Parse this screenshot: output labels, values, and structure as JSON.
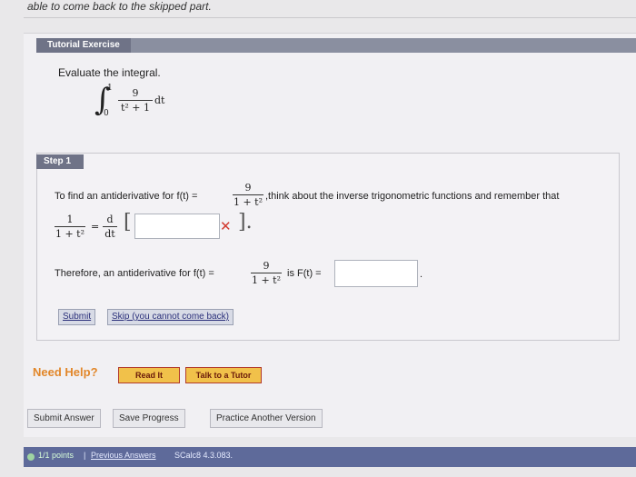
{
  "top_text": "able to come back to the skipped part.",
  "tutorial": {
    "tab_label": "Tutorial Exercise",
    "prompt": "Evaluate the integral.",
    "integral": {
      "upper": "1",
      "lower": "0",
      "numerator": "9",
      "denominator": "t² + 1",
      "differential": "dt"
    }
  },
  "step": {
    "title": "Step 1",
    "line1_before": "To find an antiderivative for f(t) =",
    "line1_frac_num": "9",
    "line1_frac_den": "1 + t²",
    "line1_after": ",think about the inverse trigonometric functions and remember that",
    "eq_left_num": "1",
    "eq_left_den": "1 + t²",
    "eq_equals": "=",
    "eq_deriv_num": "d",
    "eq_deriv_den": "dt",
    "bracket_open": "[",
    "bracket_close": "].",
    "answer1_value": "",
    "cross_mark": "✕",
    "therefore_before": "Therefore, an antiderivative for f(t) =",
    "therefore_frac_num": "9",
    "therefore_frac_den": "1 + t²",
    "therefore_after": "is F(t) =",
    "answer2_value": "",
    "period": "."
  },
  "buttons": {
    "submit": "Submit",
    "skip": "Skip (you cannot come back)",
    "read_it": "Read It",
    "talk_tutor": "Talk to a Tutor",
    "submit_answer": "Submit Answer",
    "save_progress": "Save Progress",
    "practice_another": "Practice Another Version"
  },
  "help_label": "Need Help?",
  "footer": {
    "points": "1/1 points",
    "separator": "|",
    "previous": "Previous Answers",
    "code": "SCalc8 4.3.083."
  },
  "colors": {
    "header": "#6f7387",
    "footer": "#5e6a9a",
    "error": "#d23a2f",
    "help": "#e2872a"
  }
}
